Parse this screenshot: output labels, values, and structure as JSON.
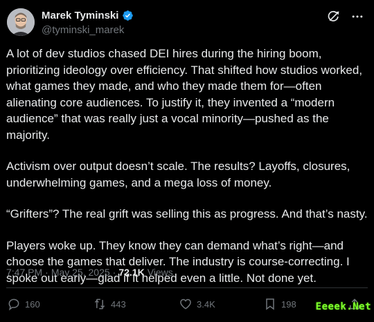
{
  "author": {
    "display_name": "Marek Tyminski",
    "handle": "@tyminski_marek",
    "verified_icon": "verified-badge-icon",
    "verified_color": "#1d9bf0"
  },
  "top_actions": {
    "grok_icon": "grok-icon",
    "more_icon": "more-icon"
  },
  "tweet": {
    "paragraphs": [
      "A lot of dev studios chased DEI hires during the hiring boom, prioritizing ideology over efficiency. That shifted how studios worked, what games they made, and who they made them for—often alienating core audiences. To justify it, they invented a “modern audience” that was really just a vocal minority—pushed as the majority.",
      "Activism over output doesn’t scale. The results? Layoffs, closures, underwhelming games, and a mega loss of money.",
      "“Grifters”? The real grift was selling this as progress. And that’s nasty.",
      "Players woke up. They know they can demand what’s right—and choose the games that deliver. The industry is course-correcting. I spoke out early—glad if it helped even a little. Not done yet."
    ]
  },
  "meta": {
    "time": "7:47 PM",
    "separator": "·",
    "date": "May 25, 2025",
    "views_count": "72.1K",
    "views_label": "Views"
  },
  "actions": {
    "replies": "160",
    "reposts": "443",
    "likes": "3.4K",
    "bookmarks": "198"
  },
  "watermark": "Eeeek.Net",
  "colors": {
    "background": "#000000",
    "text": "#e7e9ea",
    "secondary": "#71767b",
    "watermark": "#7dff2a"
  }
}
